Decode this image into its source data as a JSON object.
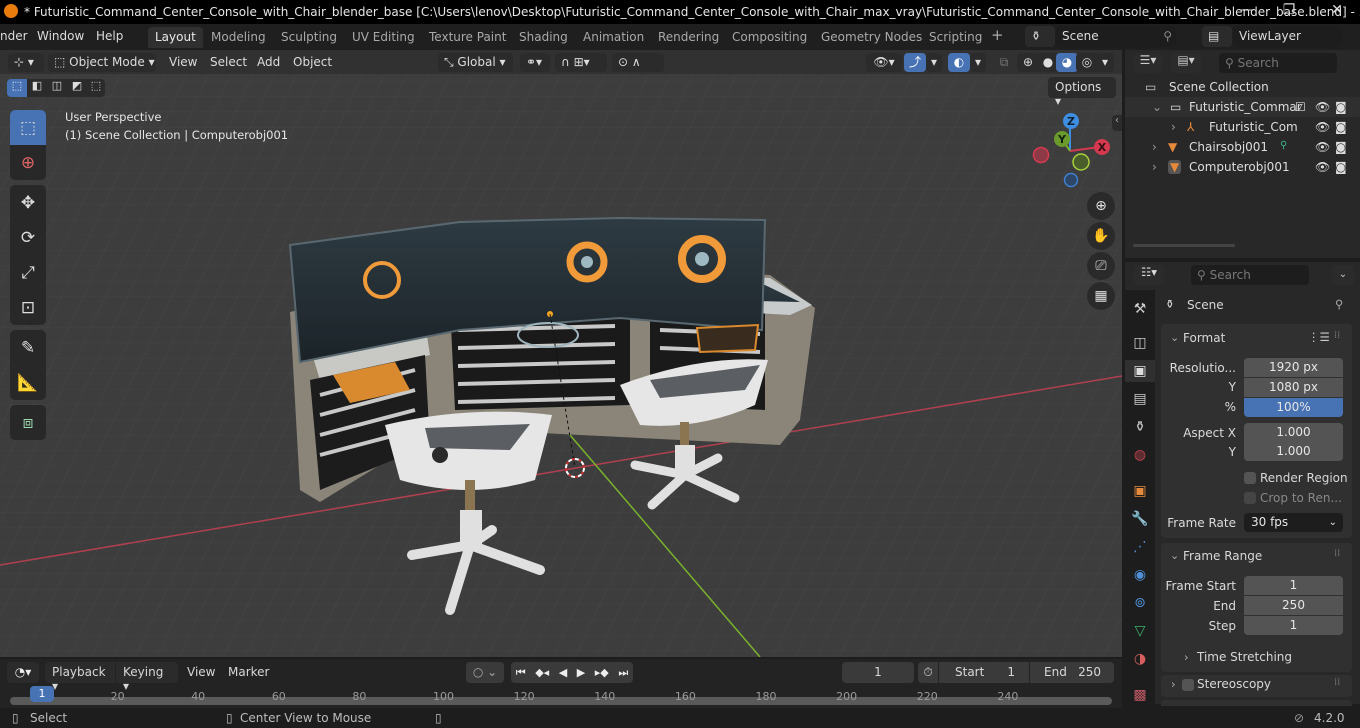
{
  "window": {
    "title": "* Futuristic_Command_Center_Console_with_Chair_blender_base [C:\\Users\\lenov\\Desktop\\Futuristic_Command_Center_Console_with_Chair_max_vray\\Futuristic_Command_Center_Console_with_Chair_blender_base.blend] - ...",
    "minimize": "—",
    "maximize": "❐",
    "close": "✕"
  },
  "menubar": {
    "menus": [
      "nder",
      "Window",
      "Help"
    ],
    "workspaces": [
      "Layout",
      "Modeling",
      "Sculpting",
      "UV Editing",
      "Texture Paint",
      "Shading",
      "Animation",
      "Rendering",
      "Compositing",
      "Geometry Nodes",
      "Scripting"
    ],
    "active_workspace": "Layout",
    "add_workspace": "+",
    "scene": "Scene",
    "view_layer": "ViewLayer"
  },
  "viewport_header": {
    "mode": "Object Mode",
    "menus": [
      "View",
      "Select",
      "Add",
      "Object"
    ],
    "orientation": "Global",
    "options": "Options"
  },
  "viewport": {
    "view_name": "User Perspective",
    "context": "(1) Scene Collection | Computerobj001",
    "gizmo_axes": [
      "Z",
      "Y",
      "X"
    ],
    "colors": {
      "x_axis": "#d4394f",
      "y_axis": "#7ab32b",
      "z_axis": "#3d8ee0",
      "accent": "#4772b3",
      "screen_orange": "#f09a3a"
    }
  },
  "outliner": {
    "search_placeholder": "Search",
    "root": "Scene Collection",
    "items": [
      {
        "name": "Futuristic_Commar",
        "type": "collection",
        "indent": 1
      },
      {
        "name": "Futuristic_Com",
        "type": "empty",
        "indent": 2
      },
      {
        "name": "Chairsobj001",
        "type": "mesh",
        "indent": 1
      },
      {
        "name": "Computerobj001",
        "type": "mesh",
        "indent": 1
      }
    ]
  },
  "properties": {
    "search_placeholder": "Search",
    "context": "Scene",
    "format": {
      "title": "Format",
      "resolution_x_label": "Resolutio...",
      "resolution_x": "1920 px",
      "resolution_y_label": "Y",
      "resolution_y": "1080 px",
      "percent_label": "%",
      "percent": "100%",
      "aspect_x_label": "Aspect X",
      "aspect_x": "1.000",
      "aspect_y_label": "Y",
      "aspect_y": "1.000",
      "render_region": "Render Region",
      "crop_region": "Crop to Ren...",
      "frame_rate_label": "Frame Rate",
      "frame_rate": "30 fps"
    },
    "frame_range": {
      "title": "Frame Range",
      "start_label": "Frame Start",
      "start": "1",
      "end_label": "End",
      "end": "250",
      "step_label": "Step",
      "step": "1",
      "time_stretching": "Time Stretching"
    },
    "stereoscopy": "Stereoscopy"
  },
  "timeline": {
    "menus": [
      "Playback",
      "Keying",
      "View",
      "Marker"
    ],
    "current_frame": "1",
    "start_label": "Start",
    "start": "1",
    "end_label": "End",
    "end": "250",
    "ruler": [
      "20",
      "40",
      "60",
      "80",
      "100",
      "120",
      "140",
      "160",
      "180",
      "200",
      "220",
      "240"
    ],
    "playhead": "1"
  },
  "statusbar": {
    "select": "Select",
    "center_view": "Center View to Mouse",
    "version": "4.2.0"
  }
}
